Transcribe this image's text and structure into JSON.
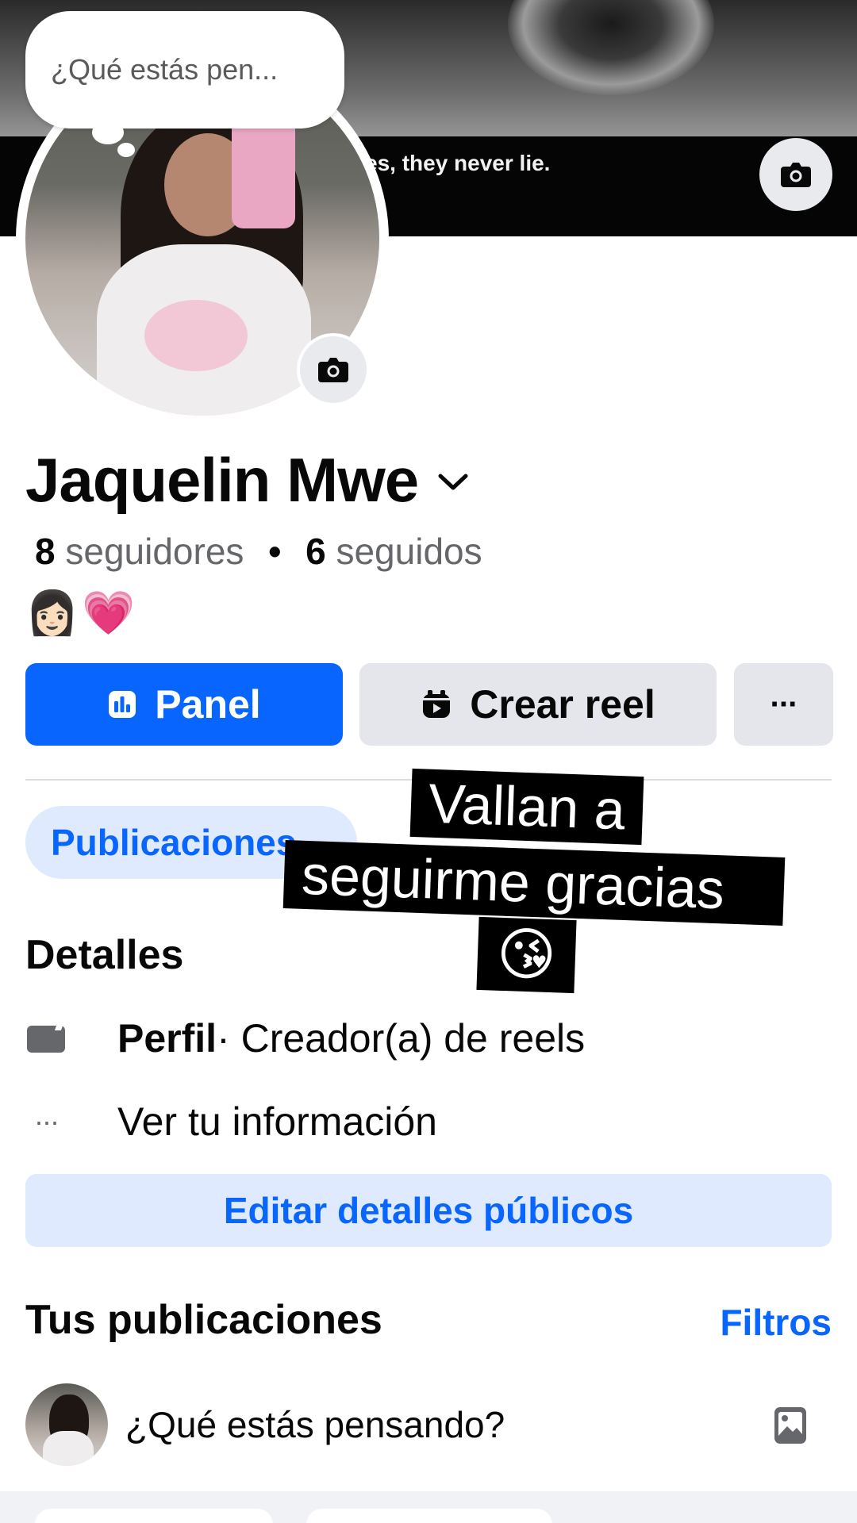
{
  "cover": {
    "caption": "es, they never lie.",
    "camera_icon": "camera-icon"
  },
  "thought_bubble": {
    "text": "¿Qué estás pen..."
  },
  "profile": {
    "name": "Jaquelin Mwe",
    "followers_count": "8",
    "followers_label": "seguidores",
    "separator": "•",
    "following_count": "6",
    "following_label": "seguidos",
    "bio": [
      "👩🏻",
      "💗"
    ]
  },
  "actions": {
    "panel_label": "Panel",
    "reel_label": "Crear reel",
    "more_label": "···"
  },
  "tabs": {
    "publicaciones_label": "Publicaciones"
  },
  "overlay_caption": {
    "line1": "Vallan a",
    "line2": "seguirme gracias",
    "line3": "😘"
  },
  "details": {
    "heading": "Detalles",
    "profile_type_strong": "Perfil",
    "profile_type_rest": " · Creador(a) de reels",
    "info_label": "Ver tu información",
    "more_dots": "···",
    "edit_button": "Editar detalles públicos"
  },
  "posts": {
    "heading": "Tus publicaciones",
    "filters_label": "Filtros",
    "composer_placeholder": "¿Qué estás pensando?"
  },
  "colors": {
    "accent": "#0866ff",
    "accent_light": "#dfeafe",
    "button_gray": "#e4e6eb",
    "muted_text": "#65676b"
  }
}
